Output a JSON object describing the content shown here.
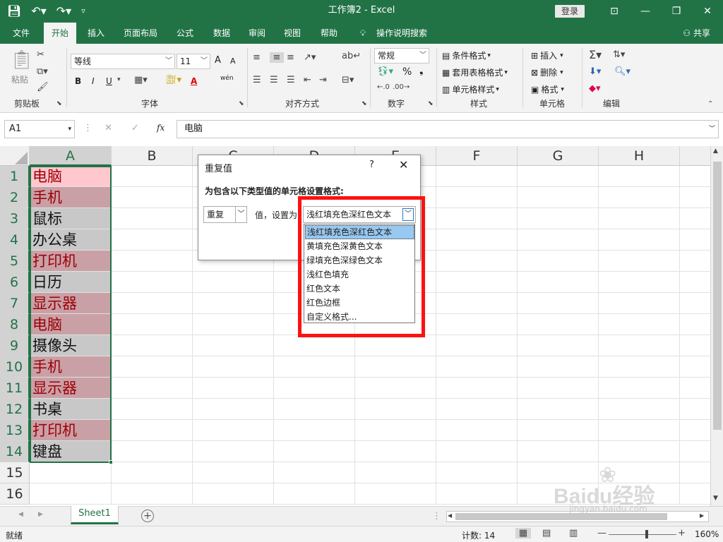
{
  "window": {
    "title": "工作簿2  -  Excel",
    "login": "登录"
  },
  "tabs": [
    "文件",
    "开始",
    "插入",
    "页面布局",
    "公式",
    "数据",
    "审阅",
    "视图",
    "帮助",
    "操作说明搜索"
  ],
  "share": "共享",
  "ribbon": {
    "clipboard": {
      "paste": "粘贴",
      "label": "剪贴板"
    },
    "font": {
      "name": "等线",
      "size": "11",
      "label": "字体",
      "bold": "B",
      "italic": "I",
      "underline": "U",
      "grow": "A",
      "shrink": "A",
      "color": "A",
      "wen": "wén"
    },
    "align": {
      "label": "对齐方式"
    },
    "number": {
      "format": "常规",
      "label": "数字",
      "percent": "%",
      "comma": "❟"
    },
    "styles": {
      "conditional": "条件格式",
      "table": "套用表格格式",
      "cell": "单元格样式",
      "label": "样式"
    },
    "cells": {
      "insert": "插入",
      "delete": "删除",
      "format": "格式",
      "label": "单元格"
    },
    "editing": {
      "label": "编辑"
    }
  },
  "formula_bar": {
    "namebox": "A1",
    "fx": "fx",
    "content": "电脑"
  },
  "columns": [
    "A",
    "B",
    "C",
    "D",
    "E",
    "F",
    "G",
    "H"
  ],
  "rows": [
    "1",
    "2",
    "3",
    "4",
    "5",
    "6",
    "7",
    "8",
    "9",
    "10",
    "11",
    "12",
    "13",
    "14",
    "15",
    "16"
  ],
  "cells": [
    {
      "text": "电脑",
      "dup": true
    },
    {
      "text": "手机",
      "dup": true
    },
    {
      "text": "鼠标",
      "dup": false
    },
    {
      "text": "办公桌",
      "dup": false
    },
    {
      "text": "打印机",
      "dup": true
    },
    {
      "text": "日历",
      "dup": false
    },
    {
      "text": "显示器",
      "dup": true
    },
    {
      "text": "电脑",
      "dup": true
    },
    {
      "text": "摄像头",
      "dup": false
    },
    {
      "text": "手机",
      "dup": true
    },
    {
      "text": "显示器",
      "dup": true
    },
    {
      "text": "书桌",
      "dup": false
    },
    {
      "text": "打印机",
      "dup": true
    },
    {
      "text": "键盘",
      "dup": false
    }
  ],
  "colors": {
    "excel_green": "#217346",
    "dup_fill": "#c9a0a6",
    "dup_fill_first": "#ffc7ce",
    "dup_text": "#9c0006",
    "sel_fill": "#c8c8c8",
    "annotation": "#ff1010"
  },
  "dialog": {
    "title": "重复值",
    "help": "?",
    "close": "✕",
    "prompt": "为包含以下类型值的单元格设置格式:",
    "type_value": "重复",
    "value_label": "值，设置为",
    "format_value": "浅红填充色深红色文本"
  },
  "dropdown": [
    "浅红填充色深红色文本",
    "黄填充色深黄色文本",
    "绿填充色深绿色文本",
    "浅红色填充",
    "红色文本",
    "红色边框",
    "自定义格式..."
  ],
  "sheet": {
    "name": "Sheet1",
    "add": "+"
  },
  "status": {
    "ready": "就绪",
    "count": "计数: 14",
    "zoom": "160%"
  },
  "watermark": {
    "brand": "Baidu经验",
    "url": "jingyan.baidu.com"
  }
}
